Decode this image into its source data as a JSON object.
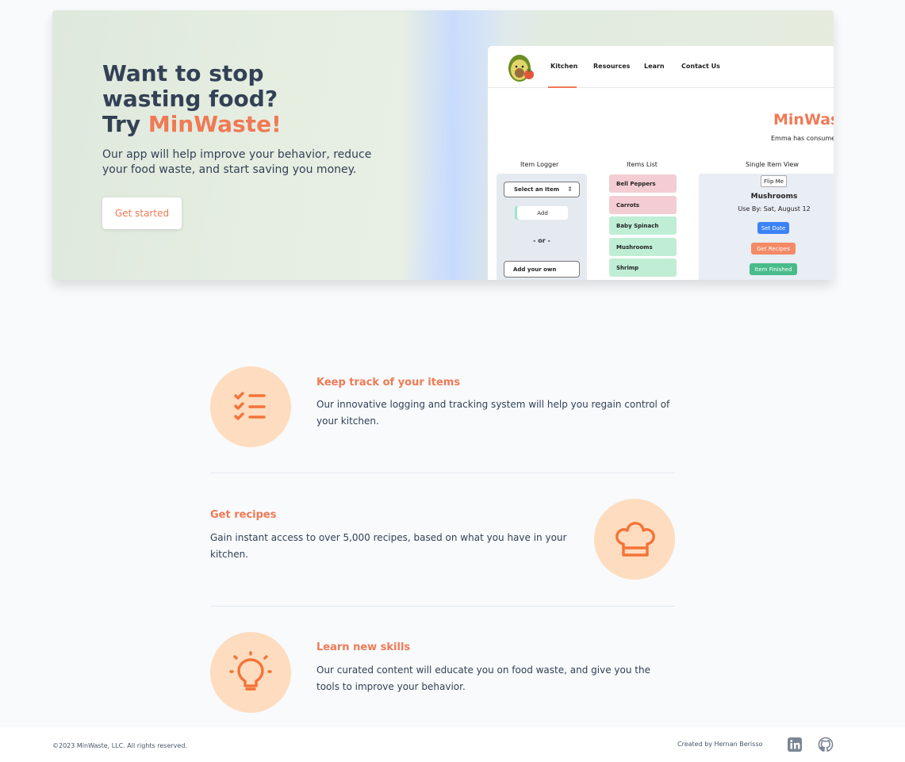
{
  "hero": {
    "title_line1": "Want to stop wasting food?",
    "title_try": "Try ",
    "title_brand": "MinWaste!",
    "subtitle": "Our app will help improve your behavior, reduce your food waste, and start saving you money.",
    "cta_label": "Get started"
  },
  "app_preview": {
    "nav": [
      "Kitchen",
      "Resources",
      "Learn",
      "Contact Us"
    ],
    "brand": "MinWaste",
    "consumed_text": "Emma has consumed",
    "columns": [
      "Item Logger",
      "Items List",
      "Single Item View"
    ],
    "select_placeholder": "Select an Item",
    "add_label": "Add",
    "or_label": "- or -",
    "own_placeholder": "Add your own",
    "items": [
      {
        "name": "Bell Peppers",
        "status": "red"
      },
      {
        "name": "Carrots",
        "status": "red"
      },
      {
        "name": "Baby Spinach",
        "status": "green"
      },
      {
        "name": "Mushrooms",
        "status": "green"
      },
      {
        "name": "Shrimp",
        "status": "green"
      }
    ],
    "flip_label": "Flip Me",
    "single_name": "Mushrooms",
    "single_date": "Use By: Sat, August 12",
    "set_date": "Set Date",
    "get_recipes": "Get Recipes",
    "item_finished": "Item Finished"
  },
  "features": [
    {
      "title": "Keep track of your items",
      "body": "Our innovative logging and tracking system will help you regain control of your kitchen.",
      "icon": "checklist-icon"
    },
    {
      "title": "Get recipes",
      "body": "Gain instant access to over 5,000 recipes, based on what you have in your kitchen.",
      "icon": "chef-hat-icon"
    },
    {
      "title": "Learn new skills",
      "body": "Our curated content will educate you on food waste, and give you the tools to improve your behavior.",
      "icon": "lightbulb-icon"
    }
  ],
  "footer": {
    "copyright": "©2023 MinWaste, LLC. All rights reserved.",
    "credit": "Created by Hernan Berisso"
  },
  "colors": {
    "accent": "#ef7a55",
    "icon_bg": "#fedcbf",
    "text": "#334155"
  }
}
